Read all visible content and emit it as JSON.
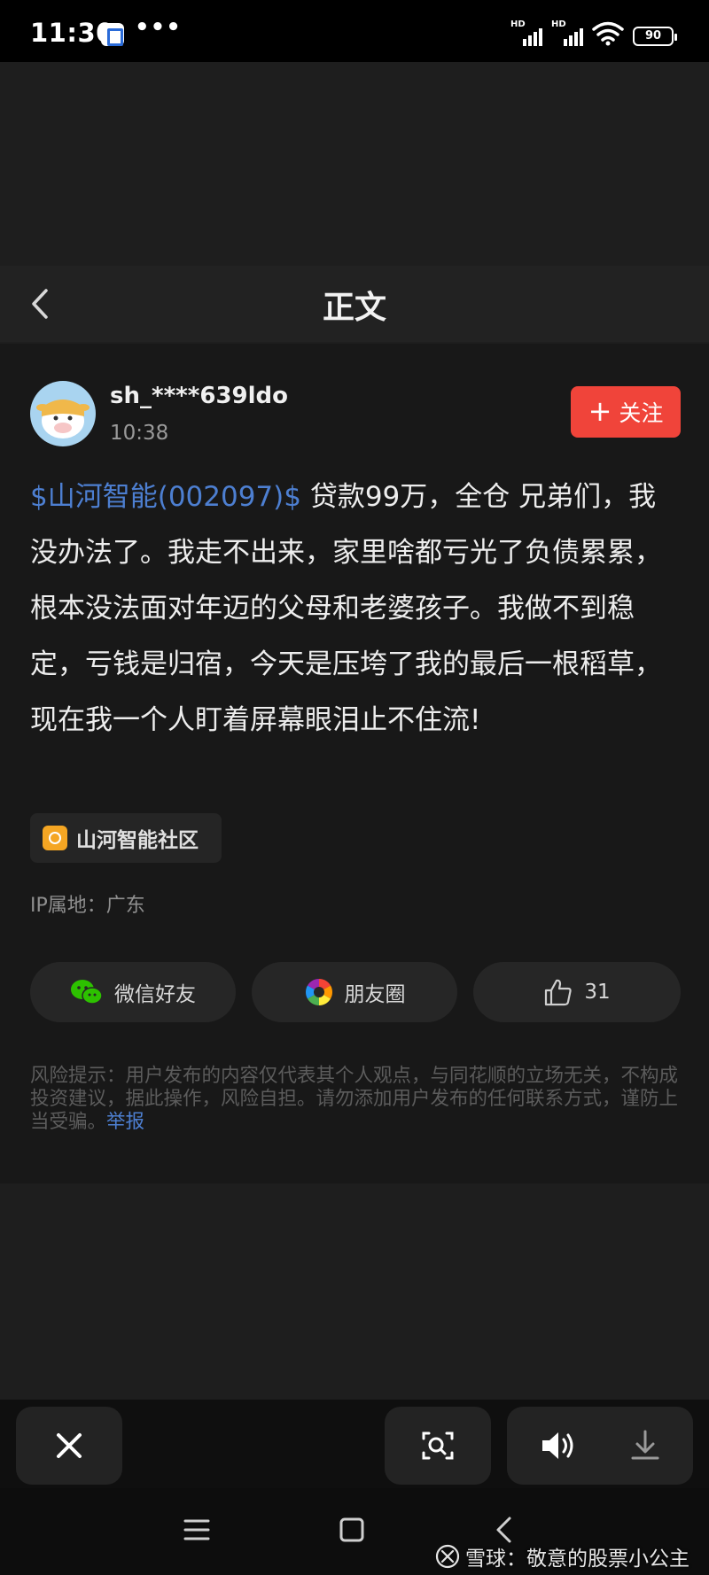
{
  "status_bar": {
    "time": "11:30",
    "dots": "•••",
    "network_label": "HD",
    "battery": "90"
  },
  "header": {
    "title": "正文"
  },
  "post": {
    "author": "sh_****639ldo",
    "time": "10:38",
    "follow_label": "关注",
    "follow_plus": "+",
    "stock_tag": "$山河智能(002097)$",
    "content": " 贷款99万，全仓 兄弟们，我没办法了。我走不出来，家里啥都亏光了负债累累，根本没法面对年迈的父母和老婆孩子。我做不到稳定，亏钱是归宿，今天是压垮了我的最后一根稻草，现在我一个人盯着屏幕眼泪止不住流!",
    "community": "山河智能社区",
    "ip_location": "IP属地：广东"
  },
  "actions": {
    "wechat_label": "微信好友",
    "moments_label": "朋友圈",
    "like_count": "31"
  },
  "risk": {
    "text": "风险提示：用户发布的内容仅代表其个人观点，与同花顺的立场无关，不构成投资建议，据此操作，风险自担。请勿添加用户发布的任何联系方式，谨防上当受骗。",
    "report_label": "举报"
  },
  "watermark": {
    "text": "雪球：敬意的股票小公主"
  },
  "colors": {
    "accent_blue": "#4d7fd1",
    "follow_red": "#f0443a",
    "wechat_green": "#2dc100",
    "community_orange": "#f5a623"
  }
}
